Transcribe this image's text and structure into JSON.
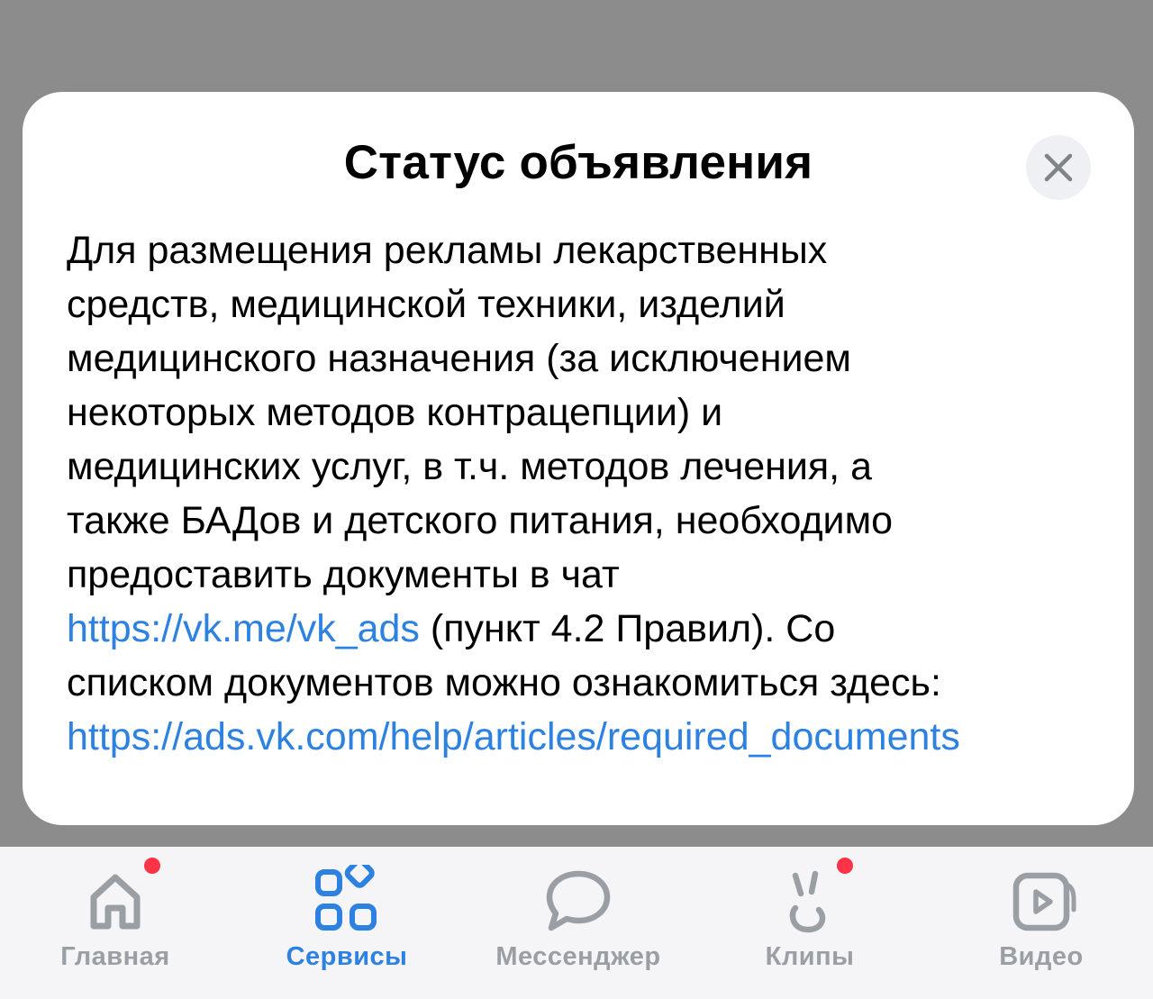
{
  "modal": {
    "title": "Статус объявления",
    "close_icon": "close-icon",
    "body": {
      "line1": "Для размещения рекламы лекарственных",
      "line2": "средств, медицинской техники, изделий",
      "line3": "медицинского назначения (за исключением",
      "line4": "некоторых методов контрацепции) и",
      "line5": "медицинских услуг, в т.ч. методов лечения, а",
      "line6": "также БАДов и детского питания, необходимо",
      "line7": "предоставить документы в чат",
      "link1": "https://vk.me/vk_ads",
      "line8_rest": " (пункт 4.2 Правил). Со",
      "line9": "списком документов можно ознакомиться здесь:",
      "link2": "https://ads.vk.com/help/articles/required_documents"
    }
  },
  "colors": {
    "accent": "#2d81e0",
    "inactive_tab": "#9a9ea5",
    "badge": "#ff3347",
    "backdrop": "#8c8c8c"
  },
  "tabbar": {
    "tabs": [
      {
        "label": "Главная",
        "icon": "home-icon",
        "active": false,
        "badge": true
      },
      {
        "label": "Сервисы",
        "icon": "services-grid-icon",
        "active": true,
        "badge": false
      },
      {
        "label": "Мессенджер",
        "icon": "chat-bubble-icon",
        "active": false,
        "badge": false
      },
      {
        "label": "Клипы",
        "icon": "clips-icon",
        "active": false,
        "badge": true
      },
      {
        "label": "Видео",
        "icon": "video-play-icon",
        "active": false,
        "badge": false
      }
    ]
  }
}
